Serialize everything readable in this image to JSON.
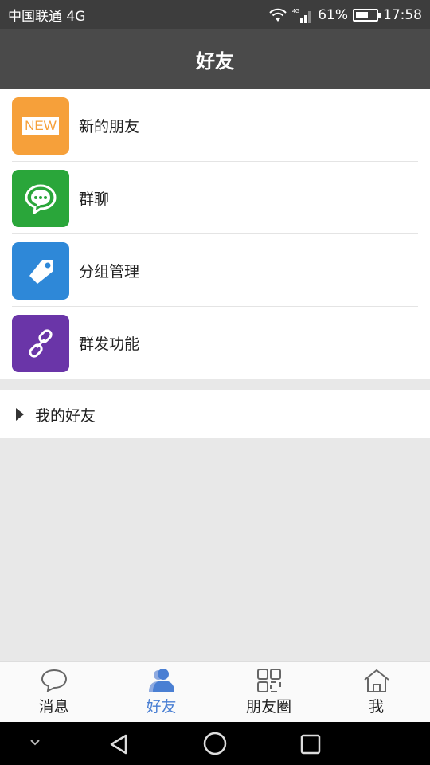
{
  "status_bar": {
    "carrier": "中国联通 4G",
    "battery_percent": "61%",
    "battery_level": 0.61,
    "time": "17:58"
  },
  "header": {
    "title": "好友"
  },
  "menu": [
    {
      "label": "新的朋友",
      "icon": "new-icon",
      "badge": "NEW",
      "color": "#f6a03a"
    },
    {
      "label": "群聊",
      "icon": "chat-bubble-icon",
      "color": "#2aa63a"
    },
    {
      "label": "分组管理",
      "icon": "tag-icon",
      "color": "#2e88d8"
    },
    {
      "label": "群发功能",
      "icon": "link-icon",
      "color": "#6a35a8"
    }
  ],
  "group": {
    "label": "我的好友"
  },
  "tabs": [
    {
      "label": "消息",
      "icon": "message-icon"
    },
    {
      "label": "好友",
      "icon": "friends-icon",
      "active": true
    },
    {
      "label": "朋友圈",
      "icon": "moments-icon"
    },
    {
      "label": "我",
      "icon": "home-icon"
    }
  ],
  "colors": {
    "accent": "#4a7fd3",
    "header_bg": "#4a4a4a"
  }
}
